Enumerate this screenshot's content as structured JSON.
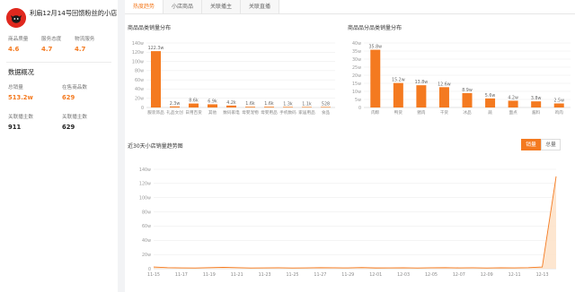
{
  "shop": {
    "name": "利扇12月14号回馈粉丝的小店"
  },
  "ratings": [
    {
      "label": "商品质量",
      "value": "4.6"
    },
    {
      "label": "服务态度",
      "value": "4.7"
    },
    {
      "label": "物流服务",
      "value": "4.7"
    }
  ],
  "overview": {
    "title": "数据概况",
    "stats": [
      {
        "label": "总销量",
        "value": "513.2w",
        "tone": "orange"
      },
      {
        "label": "在售商品数",
        "value": "629",
        "tone": "orange"
      },
      {
        "label": "关联播主数",
        "value": "911",
        "tone": "dark"
      },
      {
        "label": "关联播主数",
        "value": "629",
        "tone": "dark"
      }
    ]
  },
  "tabs": [
    {
      "label": "热度趋势",
      "active": true
    },
    {
      "label": "小店商品",
      "active": false
    },
    {
      "label": "关联播主",
      "active": false
    },
    {
      "label": "关联直播",
      "active": false
    }
  ],
  "toggle": {
    "options": [
      "销量",
      "总量"
    ],
    "selected": "销量"
  },
  "colors": {
    "accent": "#f47a20",
    "avatar": "#e0281e",
    "area_fill": "#fde2c8"
  },
  "chart_data": [
    {
      "type": "bar",
      "title": "商品品类销量分布",
      "categories": [
        "服装饰品",
        "礼品文创",
        "日用百货",
        "其他",
        "数码家电",
        "母婴宠物",
        "母婴用品",
        "手机数码",
        "家居用品",
        "食品"
      ],
      "values": [
        122.3,
        2.3,
        8.6,
        6.9,
        4.2,
        1.6,
        1.6,
        1.3,
        1.1,
        0.0528
      ],
      "value_labels": [
        "122.3w",
        "2.3w",
        "8.6k",
        "6.9k",
        "4.2k",
        "1.6k",
        "1.6k",
        "1.3k",
        "1.1k",
        "528"
      ],
      "ylim": [
        0,
        140
      ],
      "yticks": [
        "0",
        "20w",
        "40w",
        "60w",
        "80w",
        "100w",
        "120w",
        "140w"
      ],
      "grid": true
    },
    {
      "type": "bar",
      "title": "商品品分品类销量分布",
      "categories": [
        "肉粽",
        "鸭货",
        "猪肉",
        "干货",
        "冰品",
        "蔬",
        "面点",
        "酱料",
        "鸡肉"
      ],
      "values": [
        35.8,
        15.2,
        13.8,
        12.6,
        8.9,
        5.6,
        4.2,
        3.8,
        2.5
      ],
      "value_labels": [
        "35.8w",
        "15.2w",
        "13.8w",
        "12.6w",
        "8.9w",
        "5.6w",
        "4.2w",
        "3.8w",
        "2.5w"
      ],
      "display_categories": [
        "肉粽",
        "鸭货",
        "猪肉",
        "干货",
        "冰品",
        "蔬",
        "面点",
        "酱料",
        "鸡肉"
      ],
      "ylim": [
        0,
        40
      ],
      "yticks": [
        "0",
        "5w",
        "10w",
        "15w",
        "20w",
        "25w",
        "30w",
        "35w",
        "40w"
      ],
      "grid": true
    },
    {
      "type": "area",
      "title": "近30天小店销量趋势图",
      "x": [
        "11-15",
        "11-17",
        "11-19",
        "11-21",
        "11-23",
        "11-25",
        "11-27",
        "11-29",
        "12-01",
        "12-03",
        "12-05",
        "12-07",
        "12-09",
        "12-11",
        "12-13"
      ],
      "values": [
        2.5,
        1.5,
        1.2,
        1.0,
        1.5,
        2.0,
        1.5,
        1.0,
        1.2,
        1.3,
        1.0,
        1.2,
        1.5,
        1.3,
        1.2,
        1.6,
        1.1,
        1.2,
        1.4,
        1.0,
        1.3,
        1.5,
        1.2,
        1.3,
        1.0,
        1.4,
        1.2,
        1.5,
        2.5,
        130
      ],
      "ylim": [
        0,
        140
      ],
      "yticks": [
        "0",
        "20w",
        "40w",
        "60w",
        "80w",
        "100w",
        "120w",
        "140w"
      ],
      "grid": true
    }
  ],
  "chart_titles": {
    "c1": "商品品类销量分布",
    "c2": "商品品分品类销量分布",
    "c3": "近30天小店销量趋势图"
  }
}
